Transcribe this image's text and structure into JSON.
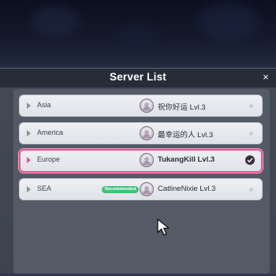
{
  "dialog": {
    "title": "Server List",
    "close_icon": "×"
  },
  "servers": [
    {
      "region": "Asia",
      "player": "祝你好运  Lvl.3",
      "selected": false,
      "recommended": false
    },
    {
      "region": "America",
      "player": "最幸运的人  Lvl.3",
      "selected": false,
      "recommended": false
    },
    {
      "region": "Europe",
      "player": "TukangKill  Lvl.3",
      "selected": true,
      "recommended": false
    },
    {
      "region": "SEA",
      "player": "CatlineNixie  Lvl.3",
      "selected": false,
      "recommended": true,
      "badge": "Recommended"
    }
  ],
  "colors": {
    "accent": "#e6558f",
    "badge": "#3cc47a",
    "header": "#272d38"
  }
}
